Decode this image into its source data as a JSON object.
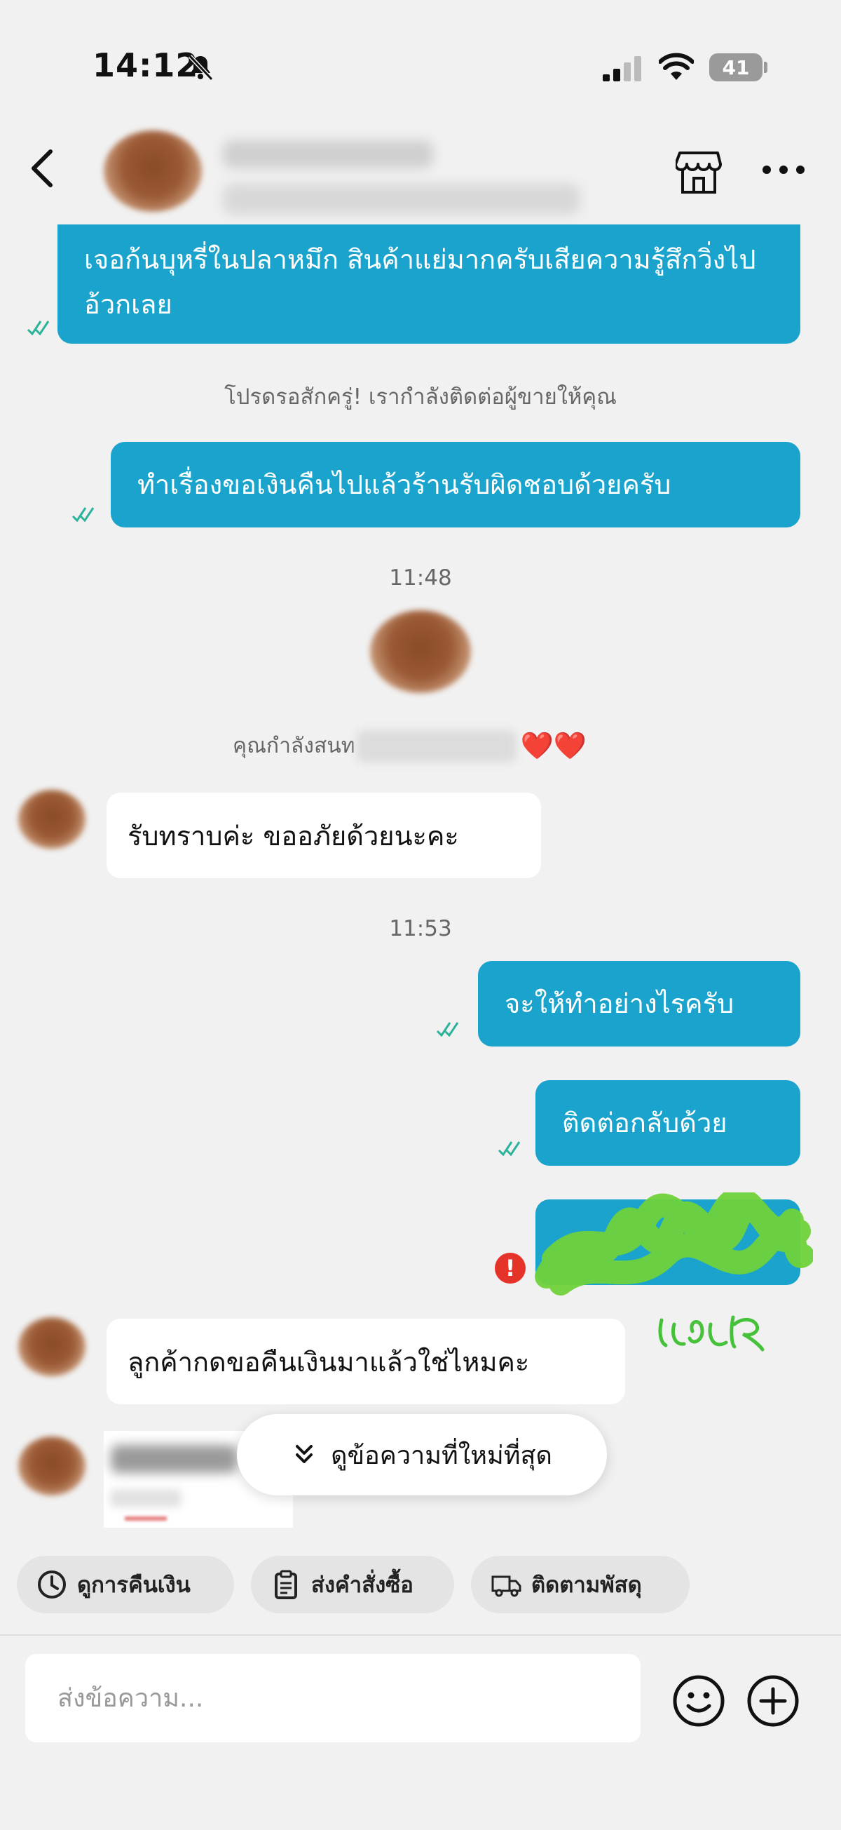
{
  "status_bar": {
    "time": "14:12",
    "battery": "41"
  },
  "header": {},
  "messages": {
    "out1": "เจอก้นบุหรี่ในปลาหมึก สินค้าแย่มากครับเสียความรู้สึกวิ่งไปอ้วกเลย",
    "system_notice": "โปรดรอสักครู่! เรากำลังติดต่อผู้ขายให้คุณ",
    "out2": "ทำเรื่องขอเงินคืนไปแล้วร้านรับผิดชอบด้วยครับ",
    "time1": "11:48",
    "love_prefix": "คุณกำลังสนท",
    "love_hearts": "❤️❤️",
    "in1": "รับทราบค่ะ ขออภัยด้วยนะคะ",
    "time2": "11:53",
    "out3": "จะให้ทำอย่างไรครับ",
    "out4": "ติดต่อกลับด้วย",
    "error_mark": "!",
    "in2": "ลูกค้ากดขอคืนเงินมาแล้วใช่ไหมคะ"
  },
  "scroll_button": {
    "label": "ดูข้อความที่ใหม่ที่สุด"
  },
  "quick_actions": [
    {
      "label": "ดูการคืนเงิน",
      "icon": "clock-icon"
    },
    {
      "label": "ส่งคำสั่งซื้อ",
      "icon": "clipboard-icon"
    },
    {
      "label": "ติดตามพัสดุ",
      "icon": "truck-icon"
    }
  ],
  "composer": {
    "placeholder": "ส่งข้อความ..."
  },
  "colors": {
    "outgoing_bubble": "#1aa3cc",
    "incoming_bubble": "#ffffff",
    "background": "#f1f1f1",
    "read_tick": "#2bb39a",
    "error": "#e5332a",
    "scribble": "#6fd23a"
  }
}
